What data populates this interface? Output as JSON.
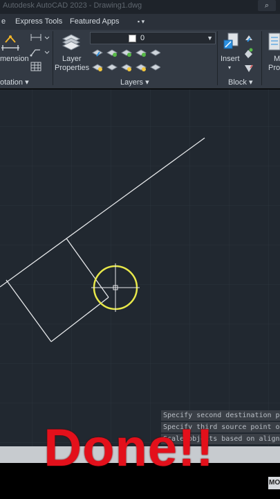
{
  "titlebar": {
    "title": "Autodesk AutoCAD 2023 - Drawing1.dwg",
    "corner_glyph": "⌕"
  },
  "tabs": {
    "items": [
      {
        "label": "e"
      },
      {
        "label": "Express Tools"
      },
      {
        "label": "Featured Apps"
      }
    ],
    "menu_glyph": "▪ ▾"
  },
  "ribbon": {
    "annotation": {
      "dimension_label": "mension",
      "panel_title": "otation ▾"
    },
    "layers": {
      "layer_properties_label_1": "Layer",
      "layer_properties_label_2": "Properties",
      "current_layer": "0",
      "panel_title": "Layers ▾"
    },
    "block": {
      "insert_label": "Insert",
      "panel_title": "Block ▾",
      "partial_label_1": "M",
      "partial_label_2": "Prop"
    }
  },
  "command_history": [
    "Specify second destination point",
    "Specify third source point or <continue>:",
    "Scale objects based on alignment points?"
  ],
  "status": {
    "mode": "MO"
  },
  "overlay_text": "Done!!",
  "colors": {
    "canvas": "#212830",
    "ribbon": "#333a44",
    "overlay": "#e3101b",
    "cursor_circle": "#e8e84a"
  }
}
